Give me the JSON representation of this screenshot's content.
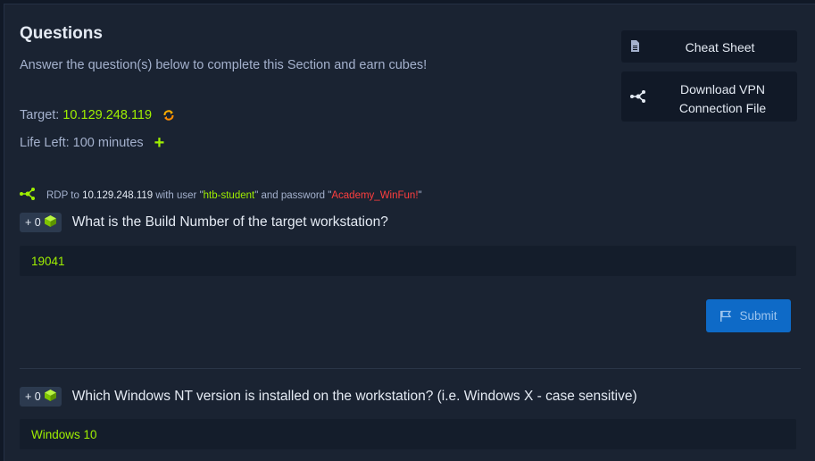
{
  "section": {
    "title": "Questions",
    "subtitle": "Answer the question(s) below to complete this Section and earn cubes!"
  },
  "target": {
    "label": "Target:",
    "ip": "10.129.248.119"
  },
  "life": {
    "label": "Life Left: 100 minutes"
  },
  "sidebar": {
    "cheat_sheet": "Cheat Sheet",
    "vpn_line1": "Download VPN",
    "vpn_line2": "Connection File"
  },
  "rdp": {
    "prefix": "RDP to ",
    "ip": "10.129.248.119",
    "mid": " with user \"",
    "user": "htb-student",
    "mid2": "\" and password \"",
    "password": "Academy_WinFun!",
    "suffix": "\""
  },
  "questions": [
    {
      "badge": "+ 0",
      "text": "What is the Build Number of the target workstation?",
      "answer": "19041"
    },
    {
      "badge": "+ 0",
      "text": "Which Windows NT version is installed on the workstation? (i.e. Windows X - case sensitive)",
      "answer": "Windows 10"
    }
  ],
  "submit_label": "Submit",
  "colors": {
    "accent_green": "#9fef00",
    "password_red": "#ff3e3e",
    "submit_blue": "#0e6ac7",
    "panel_bg": "#1a2332"
  },
  "icons": [
    "refresh-icon",
    "plus-icon",
    "document-icon",
    "network-icon",
    "cube-icon",
    "flag-icon"
  ]
}
